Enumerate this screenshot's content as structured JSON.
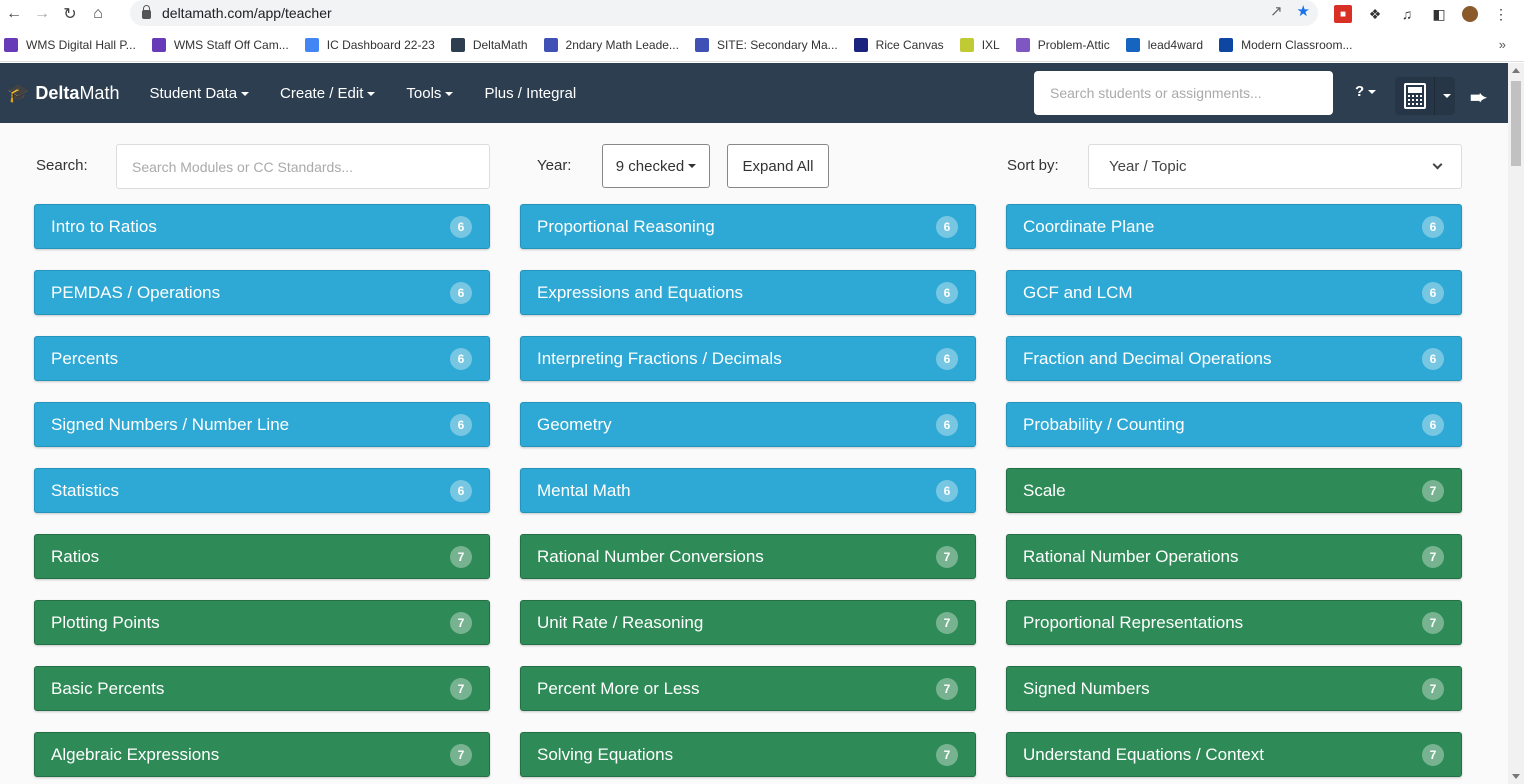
{
  "browser": {
    "url": "deltamath.com/app/teacher",
    "bookmarks": [
      {
        "label": "WMS Digital Hall P...",
        "color": "#673ab7"
      },
      {
        "label": "WMS Staff Off Cam...",
        "color": "#673ab7"
      },
      {
        "label": "IC Dashboard 22-23",
        "color": "#4285f4"
      },
      {
        "label": "DeltaMath",
        "color": "#2c3e50"
      },
      {
        "label": "2ndary Math Leade...",
        "color": "#3f51b5"
      },
      {
        "label": "SITE: Secondary Ma...",
        "color": "#3f51b5"
      },
      {
        "label": "Rice Canvas",
        "color": "#1a237e"
      },
      {
        "label": "IXL",
        "color": "#c0ca33"
      },
      {
        "label": "Problem-Attic",
        "color": "#7e57c2"
      },
      {
        "label": "lead4ward",
        "color": "#1565c0"
      },
      {
        "label": "Modern Classroom...",
        "color": "#0d47a1"
      }
    ],
    "more_bookmarks": "»"
  },
  "navbar": {
    "brand_bold": "Delta",
    "brand_rest": "Math",
    "links": [
      {
        "label": "Student Data",
        "dropdown": true
      },
      {
        "label": "Create / Edit",
        "dropdown": true
      },
      {
        "label": "Tools",
        "dropdown": true
      },
      {
        "label": "Plus / Integral",
        "dropdown": false
      }
    ],
    "search_placeholder": "Search students or assignments...",
    "help_label": "?"
  },
  "filters": {
    "search_label": "Search:",
    "search_placeholder": "Search Modules or CC Standards...",
    "year_label": "Year:",
    "year_value": "9 checked",
    "expand_label": "Expand All",
    "sort_label": "Sort by:",
    "sort_value": "Year / Topic"
  },
  "colors": {
    "year6": "#2ea9d5",
    "year7": "#2e8b57",
    "navbar": "#2c3e50"
  },
  "modules": [
    {
      "name": "Intro to Ratios",
      "year": "6"
    },
    {
      "name": "Proportional Reasoning",
      "year": "6"
    },
    {
      "name": "Coordinate Plane",
      "year": "6"
    },
    {
      "name": "PEMDAS / Operations",
      "year": "6"
    },
    {
      "name": "Expressions and Equations",
      "year": "6"
    },
    {
      "name": "GCF and LCM",
      "year": "6"
    },
    {
      "name": "Percents",
      "year": "6"
    },
    {
      "name": "Interpreting Fractions / Decimals",
      "year": "6"
    },
    {
      "name": "Fraction and Decimal Operations",
      "year": "6"
    },
    {
      "name": "Signed Numbers / Number Line",
      "year": "6"
    },
    {
      "name": "Geometry",
      "year": "6"
    },
    {
      "name": "Probability / Counting",
      "year": "6"
    },
    {
      "name": "Statistics",
      "year": "6"
    },
    {
      "name": "Mental Math",
      "year": "6"
    },
    {
      "name": "Scale",
      "year": "7"
    },
    {
      "name": "Ratios",
      "year": "7"
    },
    {
      "name": "Rational Number Conversions",
      "year": "7"
    },
    {
      "name": "Rational Number Operations",
      "year": "7"
    },
    {
      "name": "Plotting Points",
      "year": "7"
    },
    {
      "name": "Unit Rate / Reasoning",
      "year": "7"
    },
    {
      "name": "Proportional Representations",
      "year": "7"
    },
    {
      "name": "Basic Percents",
      "year": "7"
    },
    {
      "name": "Percent More or Less",
      "year": "7"
    },
    {
      "name": "Signed Numbers",
      "year": "7"
    },
    {
      "name": "Algebraic Expressions",
      "year": "7"
    },
    {
      "name": "Solving Equations",
      "year": "7"
    },
    {
      "name": "Understand Equations / Context",
      "year": "7"
    }
  ]
}
